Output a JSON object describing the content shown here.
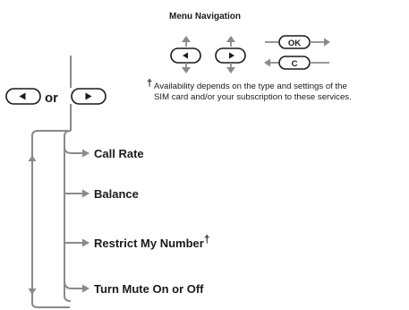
{
  "legend": {
    "title": "Menu Navigation",
    "ok_label": "OK",
    "c_label": "C"
  },
  "selector": {
    "or_label": "or"
  },
  "menu": {
    "items": [
      {
        "label": "Call Rate",
        "dagger": ""
      },
      {
        "label": "Balance",
        "dagger": ""
      },
      {
        "label": "Restrict My Number",
        "dagger": "†"
      },
      {
        "label": "Turn Mute On or Off",
        "dagger": ""
      }
    ]
  },
  "footnote": {
    "marker": "†",
    "line1": "Availability depends on the type and settings of the",
    "line2": "SIM card and/or your subscription to these services."
  },
  "colors": {
    "ink": "#1a1a1a",
    "connector_gray": "#8a8a8a",
    "background": "#ffffff"
  },
  "icons": {
    "left_key": "left-arrow-key-icon",
    "right_key": "right-arrow-key-icon",
    "ok_key": "ok-key-icon",
    "c_key": "c-key-icon"
  }
}
